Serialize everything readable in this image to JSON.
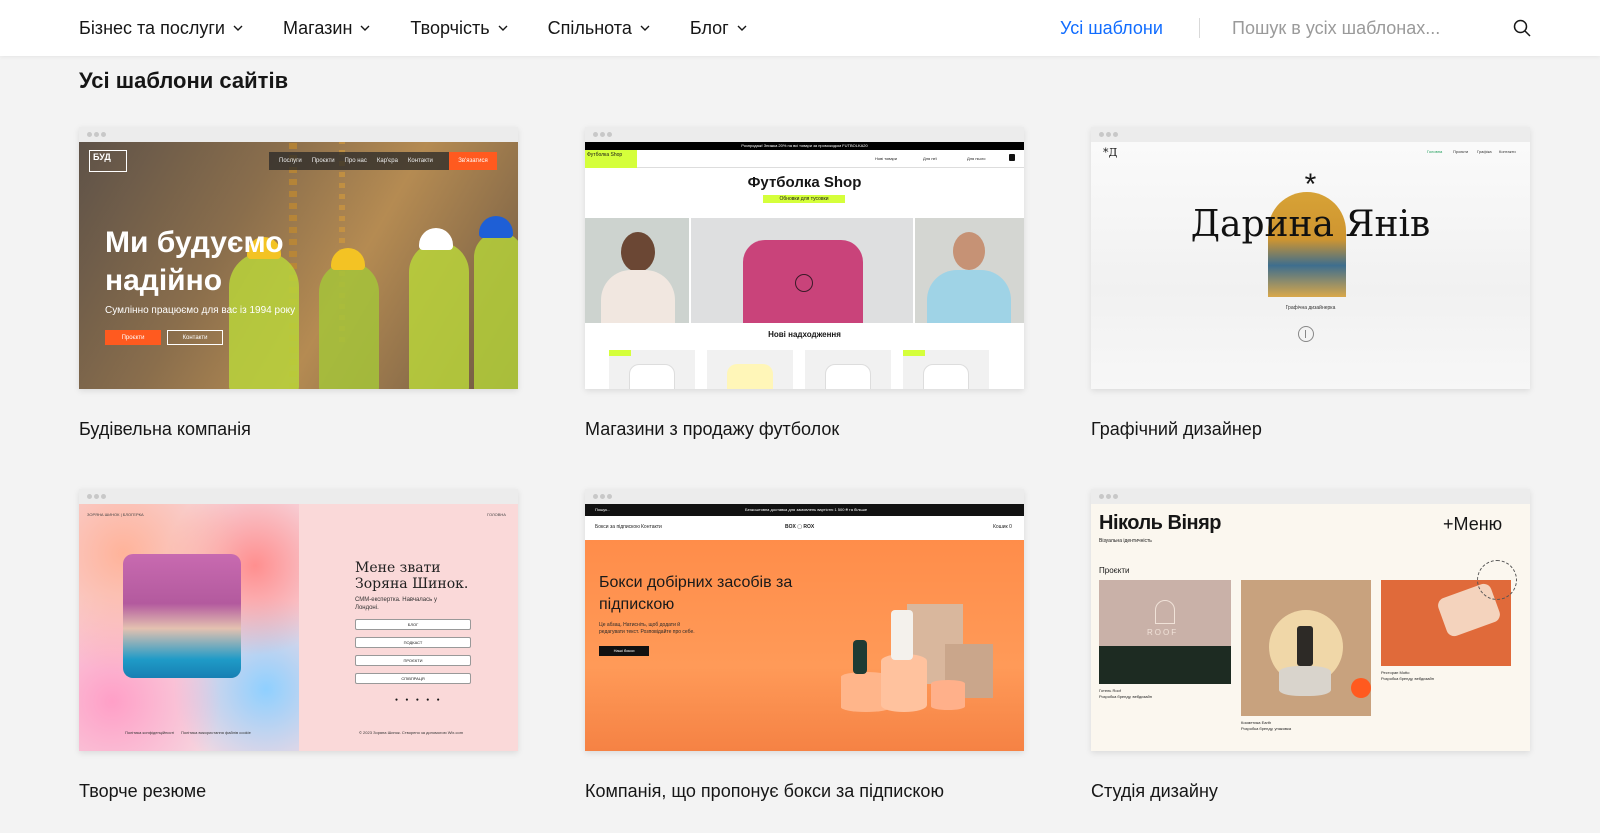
{
  "nav": {
    "menu": [
      {
        "label": "Бізнес та послуги"
      },
      {
        "label": "Магазин"
      },
      {
        "label": "Творчість"
      },
      {
        "label": "Спільнота"
      },
      {
        "label": "Блог"
      }
    ],
    "all_templates": "Усі шаблони",
    "search_placeholder": "Пошук в усіх шаблонах..."
  },
  "page_title": "Усі шаблони сайтів",
  "accent_color": "#116dff",
  "icons": {
    "dropdown": "chevron-down-icon",
    "search": "search-icon"
  },
  "templates": [
    {
      "name": "Будівельна компанія",
      "preview": {
        "logo": "БУД",
        "nav": [
          "Послуги",
          "Проєкти",
          "Про нас",
          "Кар'єра",
          "Контакти"
        ],
        "cta": "Зв'язатися",
        "heading": "Ми будуємо надійно",
        "subheading": "Сумлінно працюємо для вас із 1994 року",
        "button_primary": "Проєкти",
        "button_secondary": "Контакти"
      }
    },
    {
      "name": "Магазини з продажу футболок",
      "preview": {
        "promo": "Розпродаж! Знижка 20% на всі товари за промокодом FUTBOLKA20",
        "logo": "Футболка Shop",
        "nav": [
          "Нові товари",
          "Для неї",
          "Для нього"
        ],
        "title": "Футболка Shop",
        "pill": "Обновки для тусовки",
        "new_arrivals": "Нові надходження"
      }
    },
    {
      "name": "Графічний дизайнер",
      "preview": {
        "logo": "*Д",
        "nav": [
          "Головна",
          "Проєкти",
          "Графіка",
          "Контакти"
        ],
        "asterisk": "*",
        "name": "Дарина Янів",
        "role": "Графічна дизайнерка"
      }
    },
    {
      "name": "Творче резюме",
      "preview": {
        "top_left": "ЗОРЯНА ШИНОК | БЛОГЕРКА",
        "top_right": "ГОЛОВНА",
        "heading": "Мене звати Зоряна Шинок.",
        "caption": "СММ-експертка. Навчалась у Лондоні.",
        "links": [
          "БЛОГ",
          "ПОДКАСТ",
          "ПРОЄКТИ",
          "СПІВПРАЦЯ"
        ],
        "footer_left": "Політика конфіденційності",
        "footer_mid": "Політика використання файлів cookie",
        "footer_right": "© 2023 Зоряна Шинок. Створено за допомогою Wix.com"
      }
    },
    {
      "name": "Компанія, що пропонує бокси за підпискою",
      "preview": {
        "search": "Пошук...",
        "promo": "Безкоштовна доставка для замовлень вартістю 1 500 ₴ та більше",
        "nav": [
          "Бокси за підпискою",
          "Контакти"
        ],
        "logo": "BOX ▢ ROX",
        "cart": "Кошик 0",
        "heading": "Бокси добірних засобів за підпискою",
        "description": "Це абзац. Натисніть, щоб додати й редагувати текст. Розповідайте про себе.",
        "button": "Наші бокси"
      }
    },
    {
      "name": "Студія дизайну",
      "preview": {
        "name": "Ніколь Віняр",
        "subtitle": "Візуальна ідентичність",
        "menu": "+Меню",
        "projects_label": "Проєкти",
        "items": [
          {
            "title": "Готель Roof",
            "desc": "Розробка бренду, вебдизайн"
          },
          {
            "title": "Косметика Earth",
            "desc": "Розробка бренду, упаковка"
          },
          {
            "title": "Ресторан Motto",
            "desc": "Розробка бренду, вебдизайн"
          }
        ],
        "roof_logo": "ROOF"
      }
    }
  ]
}
